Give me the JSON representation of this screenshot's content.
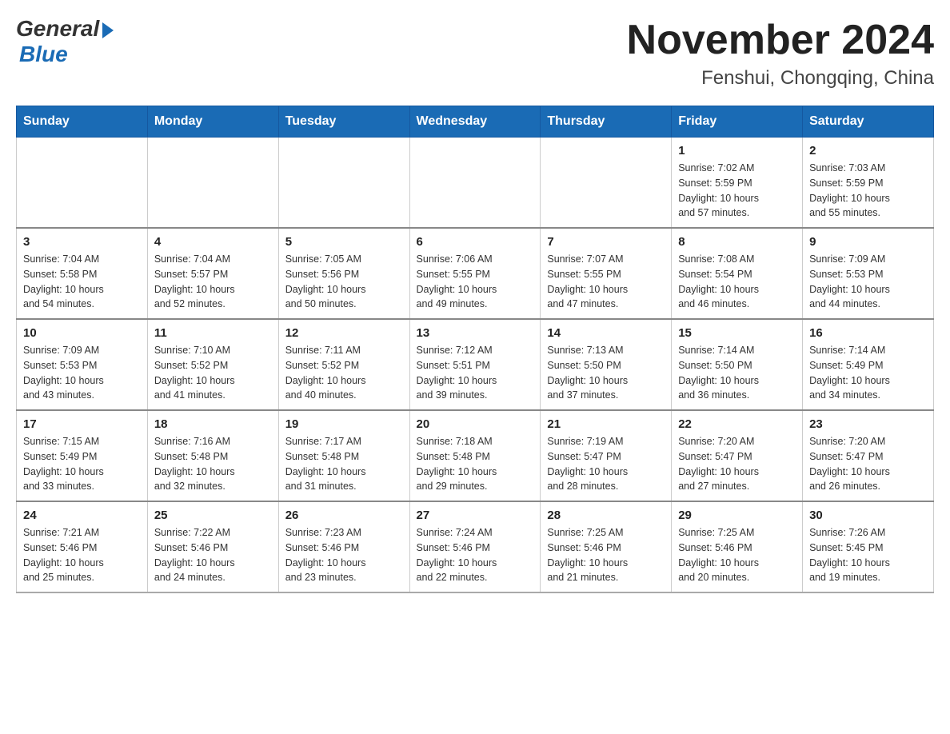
{
  "logo": {
    "general": "General",
    "blue": "Blue"
  },
  "title": "November 2024",
  "location": "Fenshui, Chongqing, China",
  "weekdays": [
    "Sunday",
    "Monday",
    "Tuesday",
    "Wednesday",
    "Thursday",
    "Friday",
    "Saturday"
  ],
  "weeks": [
    [
      {
        "day": "",
        "info": ""
      },
      {
        "day": "",
        "info": ""
      },
      {
        "day": "",
        "info": ""
      },
      {
        "day": "",
        "info": ""
      },
      {
        "day": "",
        "info": ""
      },
      {
        "day": "1",
        "info": "Sunrise: 7:02 AM\nSunset: 5:59 PM\nDaylight: 10 hours\nand 57 minutes."
      },
      {
        "day": "2",
        "info": "Sunrise: 7:03 AM\nSunset: 5:59 PM\nDaylight: 10 hours\nand 55 minutes."
      }
    ],
    [
      {
        "day": "3",
        "info": "Sunrise: 7:04 AM\nSunset: 5:58 PM\nDaylight: 10 hours\nand 54 minutes."
      },
      {
        "day": "4",
        "info": "Sunrise: 7:04 AM\nSunset: 5:57 PM\nDaylight: 10 hours\nand 52 minutes."
      },
      {
        "day": "5",
        "info": "Sunrise: 7:05 AM\nSunset: 5:56 PM\nDaylight: 10 hours\nand 50 minutes."
      },
      {
        "day": "6",
        "info": "Sunrise: 7:06 AM\nSunset: 5:55 PM\nDaylight: 10 hours\nand 49 minutes."
      },
      {
        "day": "7",
        "info": "Sunrise: 7:07 AM\nSunset: 5:55 PM\nDaylight: 10 hours\nand 47 minutes."
      },
      {
        "day": "8",
        "info": "Sunrise: 7:08 AM\nSunset: 5:54 PM\nDaylight: 10 hours\nand 46 minutes."
      },
      {
        "day": "9",
        "info": "Sunrise: 7:09 AM\nSunset: 5:53 PM\nDaylight: 10 hours\nand 44 minutes."
      }
    ],
    [
      {
        "day": "10",
        "info": "Sunrise: 7:09 AM\nSunset: 5:53 PM\nDaylight: 10 hours\nand 43 minutes."
      },
      {
        "day": "11",
        "info": "Sunrise: 7:10 AM\nSunset: 5:52 PM\nDaylight: 10 hours\nand 41 minutes."
      },
      {
        "day": "12",
        "info": "Sunrise: 7:11 AM\nSunset: 5:52 PM\nDaylight: 10 hours\nand 40 minutes."
      },
      {
        "day": "13",
        "info": "Sunrise: 7:12 AM\nSunset: 5:51 PM\nDaylight: 10 hours\nand 39 minutes."
      },
      {
        "day": "14",
        "info": "Sunrise: 7:13 AM\nSunset: 5:50 PM\nDaylight: 10 hours\nand 37 minutes."
      },
      {
        "day": "15",
        "info": "Sunrise: 7:14 AM\nSunset: 5:50 PM\nDaylight: 10 hours\nand 36 minutes."
      },
      {
        "day": "16",
        "info": "Sunrise: 7:14 AM\nSunset: 5:49 PM\nDaylight: 10 hours\nand 34 minutes."
      }
    ],
    [
      {
        "day": "17",
        "info": "Sunrise: 7:15 AM\nSunset: 5:49 PM\nDaylight: 10 hours\nand 33 minutes."
      },
      {
        "day": "18",
        "info": "Sunrise: 7:16 AM\nSunset: 5:48 PM\nDaylight: 10 hours\nand 32 minutes."
      },
      {
        "day": "19",
        "info": "Sunrise: 7:17 AM\nSunset: 5:48 PM\nDaylight: 10 hours\nand 31 minutes."
      },
      {
        "day": "20",
        "info": "Sunrise: 7:18 AM\nSunset: 5:48 PM\nDaylight: 10 hours\nand 29 minutes."
      },
      {
        "day": "21",
        "info": "Sunrise: 7:19 AM\nSunset: 5:47 PM\nDaylight: 10 hours\nand 28 minutes."
      },
      {
        "day": "22",
        "info": "Sunrise: 7:20 AM\nSunset: 5:47 PM\nDaylight: 10 hours\nand 27 minutes."
      },
      {
        "day": "23",
        "info": "Sunrise: 7:20 AM\nSunset: 5:47 PM\nDaylight: 10 hours\nand 26 minutes."
      }
    ],
    [
      {
        "day": "24",
        "info": "Sunrise: 7:21 AM\nSunset: 5:46 PM\nDaylight: 10 hours\nand 25 minutes."
      },
      {
        "day": "25",
        "info": "Sunrise: 7:22 AM\nSunset: 5:46 PM\nDaylight: 10 hours\nand 24 minutes."
      },
      {
        "day": "26",
        "info": "Sunrise: 7:23 AM\nSunset: 5:46 PM\nDaylight: 10 hours\nand 23 minutes."
      },
      {
        "day": "27",
        "info": "Sunrise: 7:24 AM\nSunset: 5:46 PM\nDaylight: 10 hours\nand 22 minutes."
      },
      {
        "day": "28",
        "info": "Sunrise: 7:25 AM\nSunset: 5:46 PM\nDaylight: 10 hours\nand 21 minutes."
      },
      {
        "day": "29",
        "info": "Sunrise: 7:25 AM\nSunset: 5:46 PM\nDaylight: 10 hours\nand 20 minutes."
      },
      {
        "day": "30",
        "info": "Sunrise: 7:26 AM\nSunset: 5:45 PM\nDaylight: 10 hours\nand 19 minutes."
      }
    ]
  ]
}
